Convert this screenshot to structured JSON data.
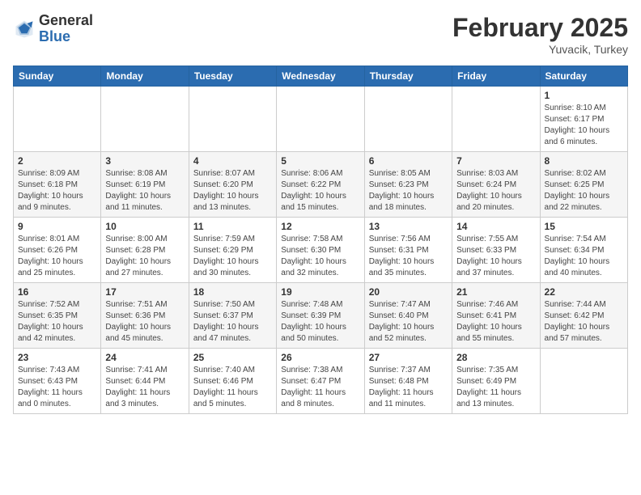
{
  "header": {
    "logo_general": "General",
    "logo_blue": "Blue",
    "month_title": "February 2025",
    "subtitle": "Yuvacik, Turkey"
  },
  "days_of_week": [
    "Sunday",
    "Monday",
    "Tuesday",
    "Wednesday",
    "Thursday",
    "Friday",
    "Saturday"
  ],
  "weeks": [
    [
      {
        "day": "",
        "info": ""
      },
      {
        "day": "",
        "info": ""
      },
      {
        "day": "",
        "info": ""
      },
      {
        "day": "",
        "info": ""
      },
      {
        "day": "",
        "info": ""
      },
      {
        "day": "",
        "info": ""
      },
      {
        "day": "1",
        "info": "Sunrise: 8:10 AM\nSunset: 6:17 PM\nDaylight: 10 hours\nand 6 minutes."
      }
    ],
    [
      {
        "day": "2",
        "info": "Sunrise: 8:09 AM\nSunset: 6:18 PM\nDaylight: 10 hours\nand 9 minutes."
      },
      {
        "day": "3",
        "info": "Sunrise: 8:08 AM\nSunset: 6:19 PM\nDaylight: 10 hours\nand 11 minutes."
      },
      {
        "day": "4",
        "info": "Sunrise: 8:07 AM\nSunset: 6:20 PM\nDaylight: 10 hours\nand 13 minutes."
      },
      {
        "day": "5",
        "info": "Sunrise: 8:06 AM\nSunset: 6:22 PM\nDaylight: 10 hours\nand 15 minutes."
      },
      {
        "day": "6",
        "info": "Sunrise: 8:05 AM\nSunset: 6:23 PM\nDaylight: 10 hours\nand 18 minutes."
      },
      {
        "day": "7",
        "info": "Sunrise: 8:03 AM\nSunset: 6:24 PM\nDaylight: 10 hours\nand 20 minutes."
      },
      {
        "day": "8",
        "info": "Sunrise: 8:02 AM\nSunset: 6:25 PM\nDaylight: 10 hours\nand 22 minutes."
      }
    ],
    [
      {
        "day": "9",
        "info": "Sunrise: 8:01 AM\nSunset: 6:26 PM\nDaylight: 10 hours\nand 25 minutes."
      },
      {
        "day": "10",
        "info": "Sunrise: 8:00 AM\nSunset: 6:28 PM\nDaylight: 10 hours\nand 27 minutes."
      },
      {
        "day": "11",
        "info": "Sunrise: 7:59 AM\nSunset: 6:29 PM\nDaylight: 10 hours\nand 30 minutes."
      },
      {
        "day": "12",
        "info": "Sunrise: 7:58 AM\nSunset: 6:30 PM\nDaylight: 10 hours\nand 32 minutes."
      },
      {
        "day": "13",
        "info": "Sunrise: 7:56 AM\nSunset: 6:31 PM\nDaylight: 10 hours\nand 35 minutes."
      },
      {
        "day": "14",
        "info": "Sunrise: 7:55 AM\nSunset: 6:33 PM\nDaylight: 10 hours\nand 37 minutes."
      },
      {
        "day": "15",
        "info": "Sunrise: 7:54 AM\nSunset: 6:34 PM\nDaylight: 10 hours\nand 40 minutes."
      }
    ],
    [
      {
        "day": "16",
        "info": "Sunrise: 7:52 AM\nSunset: 6:35 PM\nDaylight: 10 hours\nand 42 minutes."
      },
      {
        "day": "17",
        "info": "Sunrise: 7:51 AM\nSunset: 6:36 PM\nDaylight: 10 hours\nand 45 minutes."
      },
      {
        "day": "18",
        "info": "Sunrise: 7:50 AM\nSunset: 6:37 PM\nDaylight: 10 hours\nand 47 minutes."
      },
      {
        "day": "19",
        "info": "Sunrise: 7:48 AM\nSunset: 6:39 PM\nDaylight: 10 hours\nand 50 minutes."
      },
      {
        "day": "20",
        "info": "Sunrise: 7:47 AM\nSunset: 6:40 PM\nDaylight: 10 hours\nand 52 minutes."
      },
      {
        "day": "21",
        "info": "Sunrise: 7:46 AM\nSunset: 6:41 PM\nDaylight: 10 hours\nand 55 minutes."
      },
      {
        "day": "22",
        "info": "Sunrise: 7:44 AM\nSunset: 6:42 PM\nDaylight: 10 hours\nand 57 minutes."
      }
    ],
    [
      {
        "day": "23",
        "info": "Sunrise: 7:43 AM\nSunset: 6:43 PM\nDaylight: 11 hours\nand 0 minutes."
      },
      {
        "day": "24",
        "info": "Sunrise: 7:41 AM\nSunset: 6:44 PM\nDaylight: 11 hours\nand 3 minutes."
      },
      {
        "day": "25",
        "info": "Sunrise: 7:40 AM\nSunset: 6:46 PM\nDaylight: 11 hours\nand 5 minutes."
      },
      {
        "day": "26",
        "info": "Sunrise: 7:38 AM\nSunset: 6:47 PM\nDaylight: 11 hours\nand 8 minutes."
      },
      {
        "day": "27",
        "info": "Sunrise: 7:37 AM\nSunset: 6:48 PM\nDaylight: 11 hours\nand 11 minutes."
      },
      {
        "day": "28",
        "info": "Sunrise: 7:35 AM\nSunset: 6:49 PM\nDaylight: 11 hours\nand 13 minutes."
      },
      {
        "day": "",
        "info": ""
      }
    ]
  ]
}
